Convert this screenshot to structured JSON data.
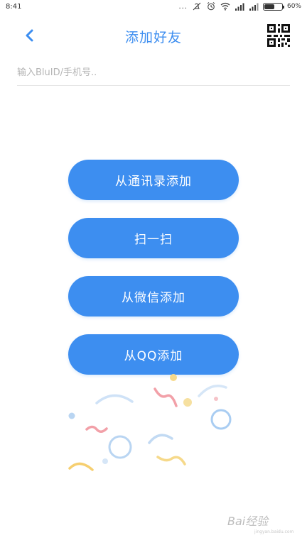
{
  "status_bar": {
    "time": "8:41",
    "dots": "...",
    "battery_percent": "60%",
    "battery_level": 0.6
  },
  "nav": {
    "title": "添加好友",
    "back_icon": "chevron-left-icon",
    "qr_icon": "qr-code-icon"
  },
  "search": {
    "value": "",
    "placeholder": "输入BluID/手机号.."
  },
  "actions": [
    {
      "label": "从通讯录添加"
    },
    {
      "label": "扫一扫"
    },
    {
      "label": "从微信添加"
    },
    {
      "label": "从QQ添加"
    }
  ],
  "colors": {
    "accent": "#3d8ef0",
    "confetti_pink": "#f2a0a8",
    "confetti_yellow": "#f6cf70",
    "confetti_blue": "#a9cdf2"
  },
  "watermark": {
    "text": "Bai经验",
    "url_text": "jingyan.baidu.com"
  }
}
